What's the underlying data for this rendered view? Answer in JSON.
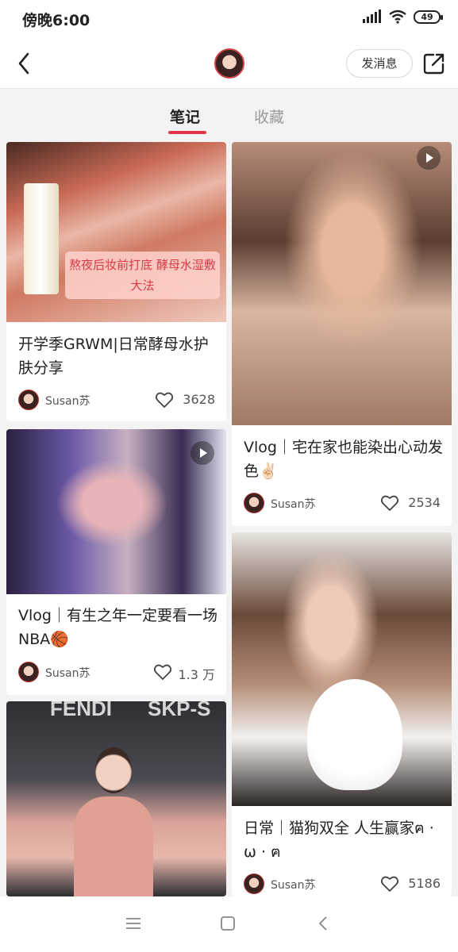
{
  "status_bar": {
    "time": "傍晚6:00",
    "battery": "49"
  },
  "header": {
    "message_button": "发消息"
  },
  "tabs": [
    {
      "label": "笔记",
      "active": true
    },
    {
      "label": "收藏",
      "active": false
    }
  ],
  "notes": [
    {
      "title": "开学季GRWM|日常酵母水护肤分享",
      "overlay_caption": "熬夜后妆前打底 酵母水湿敷大法",
      "author": "Susan苏",
      "likes": "3628",
      "video": false
    },
    {
      "title": "Vlog｜宅在家也能染出心动发色✌🏻",
      "author": "Susan苏",
      "likes": "2534",
      "video": true
    },
    {
      "title": "Vlog｜有生之年一定要看一场NBA🏀",
      "author": "Susan苏",
      "likes": "1.3 万",
      "video": true
    },
    {
      "title": "日常｜猫狗双全 人生赢家ฅ · ω · ฅ",
      "author": "Susan苏",
      "likes": "5186",
      "video": false
    },
    {
      "title": "",
      "image_text": [
        "FENDI",
        "SKP-S"
      ],
      "video": false
    }
  ],
  "colors": {
    "accent": "#e2364b",
    "background": "#f3f3f3"
  }
}
